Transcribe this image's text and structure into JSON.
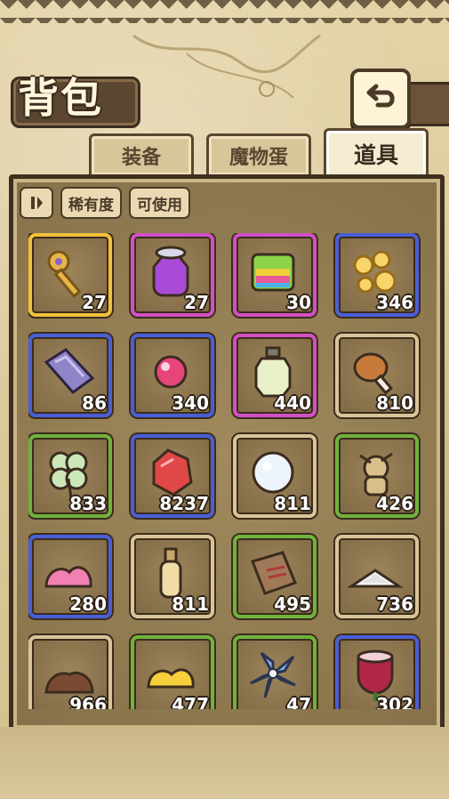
{
  "title": "背包",
  "back_icon": "return-arrow-icon",
  "tabs": [
    {
      "label": "装备",
      "active": false
    },
    {
      "label": "魔物蛋",
      "active": false
    },
    {
      "label": "道具",
      "active": true
    }
  ],
  "filters": {
    "toggle_icon": "pause-filter-icon",
    "rarity_label": "稀有度",
    "usable_label": "可使用"
  },
  "colors": {
    "gold": "#f2c13b",
    "purple": "#d24fc4",
    "blue": "#4a5ed6",
    "brown": "#d9c49a",
    "green": "#6fb23c"
  },
  "items": [
    {
      "icon": "golden-key-icon",
      "count": "27",
      "rarity": "gold"
    },
    {
      "icon": "purple-potion-icon",
      "count": "27",
      "rarity": "purple"
    },
    {
      "icon": "rainbow-block-icon",
      "count": "30",
      "rarity": "purple"
    },
    {
      "icon": "gold-coins-icon",
      "count": "346",
      "rarity": "blue"
    },
    {
      "icon": "crystal-bar-icon",
      "count": "86",
      "rarity": "blue"
    },
    {
      "icon": "pink-orb-icon",
      "count": "340",
      "rarity": "blue"
    },
    {
      "icon": "lantern-icon",
      "count": "440",
      "rarity": "purple"
    },
    {
      "icon": "meat-drumstick-icon",
      "count": "810",
      "rarity": "brown"
    },
    {
      "icon": "four-leaf-clover-icon",
      "count": "833",
      "rarity": "green"
    },
    {
      "icon": "red-gem-icon",
      "count": "8237",
      "rarity": "blue"
    },
    {
      "icon": "white-fluff-icon",
      "count": "811",
      "rarity": "brown"
    },
    {
      "icon": "voodoo-doll-icon",
      "count": "426",
      "rarity": "green"
    },
    {
      "icon": "pink-slime-icon",
      "count": "280",
      "rarity": "blue"
    },
    {
      "icon": "oil-bottle-icon",
      "count": "811",
      "rarity": "brown"
    },
    {
      "icon": "tag-plank-icon",
      "count": "495",
      "rarity": "green"
    },
    {
      "icon": "salt-pile-icon",
      "count": "736",
      "rarity": "brown"
    },
    {
      "icon": "dirt-pile-icon",
      "count": "966",
      "rarity": "brown"
    },
    {
      "icon": "yellow-slime-icon",
      "count": "477",
      "rarity": "green"
    },
    {
      "icon": "blue-flower-icon",
      "count": "47",
      "rarity": "green"
    },
    {
      "icon": "red-flower-icon",
      "count": "302",
      "rarity": "blue"
    }
  ]
}
